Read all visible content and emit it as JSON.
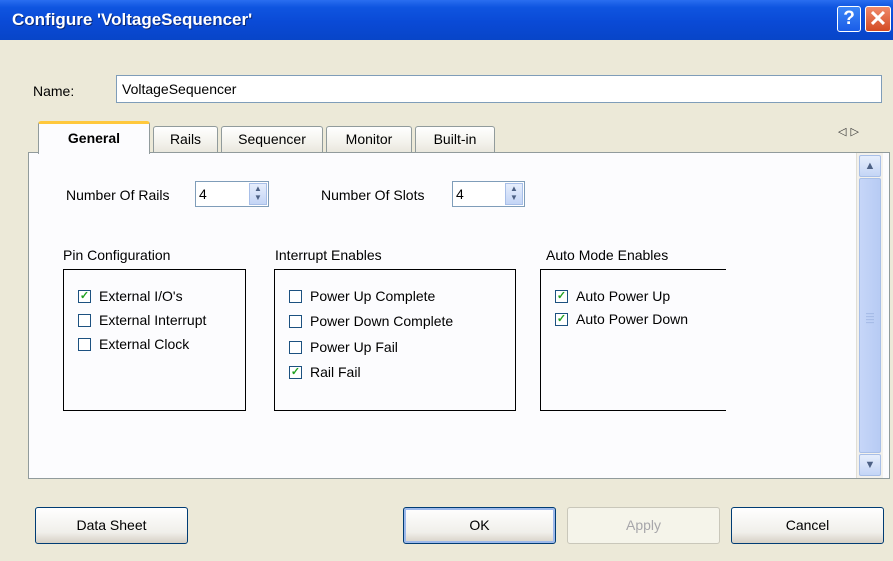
{
  "window": {
    "title": "Configure 'VoltageSequencer'"
  },
  "titlebar_buttons": {
    "help": "?",
    "close": "✕"
  },
  "name": {
    "label": "Name:",
    "value": "VoltageSequencer"
  },
  "tabs": [
    {
      "label": "General",
      "active": true
    },
    {
      "label": "Rails",
      "active": false
    },
    {
      "label": "Sequencer",
      "active": false
    },
    {
      "label": "Monitor",
      "active": false
    },
    {
      "label": "Built-in",
      "active": false
    }
  ],
  "tab_scroll": {
    "left": "◁",
    "right": "▷"
  },
  "general": {
    "rails": {
      "label": "Number Of Rails",
      "value": "4"
    },
    "slots": {
      "label": "Number Of Slots",
      "value": "4"
    },
    "pin_config": {
      "title": "Pin Configuration",
      "items": [
        {
          "label": "External I/O's",
          "checked": true
        },
        {
          "label": "External Interrupt",
          "checked": false
        },
        {
          "label": "External Clock",
          "checked": false
        }
      ]
    },
    "interrupts": {
      "title": "Interrupt Enables",
      "items": [
        {
          "label": "Power Up Complete",
          "checked": false
        },
        {
          "label": "Power Down Complete",
          "checked": false
        },
        {
          "label": "Power Up Fail",
          "checked": false
        },
        {
          "label": "Rail Fail",
          "checked": true
        }
      ]
    },
    "auto_mode": {
      "title": "Auto Mode Enables",
      "items": [
        {
          "label": "Auto Power Up",
          "checked": true
        },
        {
          "label": "Auto Power Down",
          "checked": true
        }
      ]
    }
  },
  "buttons": {
    "datasheet": "Data Sheet",
    "ok": "OK",
    "apply": "Apply",
    "cancel": "Cancel"
  },
  "colors": {
    "titlebar": "#0a4ad6",
    "check": "#21a121",
    "tab_highlight": "#ffc83c",
    "dialog_bg": "#ece9d8"
  }
}
